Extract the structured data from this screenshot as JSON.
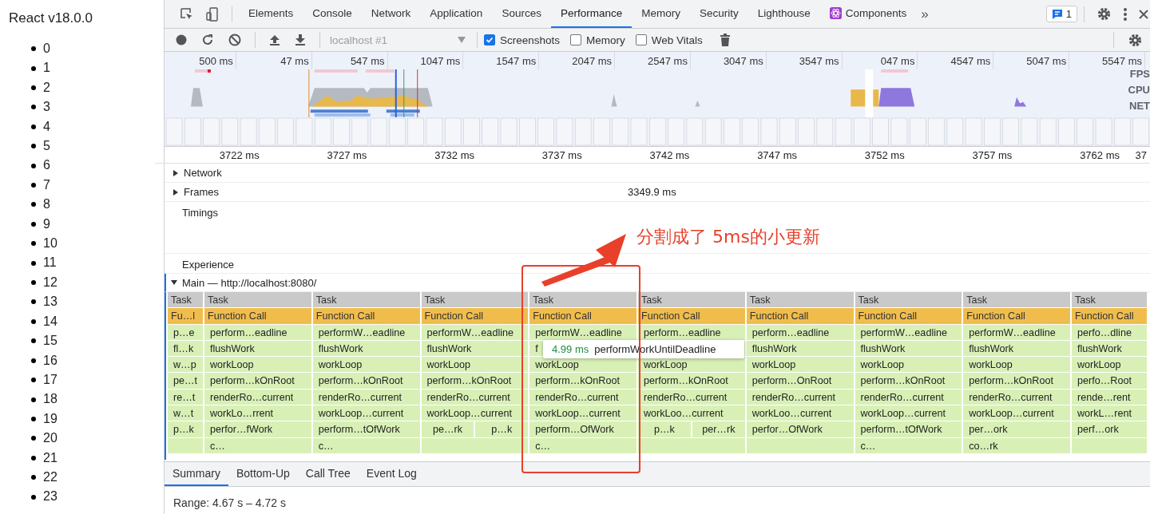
{
  "page": {
    "title": "React v18.0.0",
    "items": [
      "0",
      "1",
      "2",
      "3",
      "4",
      "5",
      "6",
      "7",
      "8",
      "9",
      "10",
      "11",
      "12",
      "13",
      "14",
      "15",
      "16",
      "17",
      "18",
      "19",
      "20",
      "21",
      "22",
      "23"
    ]
  },
  "devtools": {
    "tabs": [
      {
        "label": "Elements",
        "kind": "panel",
        "selected": false
      },
      {
        "label": "Console",
        "kind": "panel",
        "selected": false
      },
      {
        "label": "Network",
        "kind": "panel",
        "selected": false
      },
      {
        "label": "Application",
        "kind": "panel",
        "selected": false
      },
      {
        "label": "Sources",
        "kind": "panel",
        "selected": false
      },
      {
        "label": "Performance",
        "kind": "panel",
        "selected": true
      },
      {
        "label": "Memory",
        "kind": "panel",
        "selected": false
      },
      {
        "label": "Security",
        "kind": "panel",
        "selected": false
      },
      {
        "label": "Lighthouse",
        "kind": "panel",
        "selected": false
      },
      {
        "label": "Components",
        "kind": "plugin",
        "selected": false
      }
    ],
    "more": "»",
    "issues_count": "1",
    "toolbar": {
      "profile": "localhost #1",
      "checkboxes": [
        {
          "label": "Screenshots",
          "checked": true
        },
        {
          "label": "Memory",
          "checked": false
        },
        {
          "label": "Web Vitals",
          "checked": false
        }
      ]
    },
    "overview": {
      "ticks": [
        "500 ms",
        "47 ms",
        "547 ms",
        "1047 ms",
        "1547 ms",
        "2047 ms",
        "2547 ms",
        "3047 ms",
        "3547 ms",
        "047 ms",
        "4547 ms",
        "5047 ms",
        "5547 ms"
      ],
      "lanes": [
        "FPS",
        "CPU",
        "NET"
      ]
    },
    "ruler": [
      "3722 ms",
      "3727 ms",
      "3732 ms",
      "3737 ms",
      "3742 ms",
      "3747 ms",
      "3752 ms",
      "3757 ms",
      "3762 ms",
      "37"
    ],
    "tracks": [
      {
        "kind": "group",
        "label": "Network",
        "expanded": false
      },
      {
        "kind": "group",
        "label": "Frames",
        "expanded": false,
        "value": "3349.9 ms"
      },
      {
        "kind": "plain",
        "label": "Timings"
      },
      {
        "kind": "plain",
        "label": "Experience"
      }
    ],
    "main": {
      "label": "Main — http://localhost:8080/",
      "expanded": true
    },
    "flame": [
      {
        "task": "Task",
        "call": "Fu…l",
        "frames": [
          {
            "kind": "frame",
            "label": "p…e"
          },
          {
            "kind": "frame",
            "label": "fl…k"
          },
          {
            "kind": "frame",
            "label": "w…p"
          },
          {
            "kind": "frame",
            "label": "pe…t"
          },
          {
            "kind": "frame",
            "label": "re…t"
          },
          {
            "kind": "frame",
            "label": "w…t"
          },
          {
            "kind": "frame",
            "label": "p…k"
          }
        ]
      },
      {
        "task": "Task",
        "call": "Function Call",
        "frames": [
          {
            "kind": "frame",
            "label": "perform…eadline"
          },
          {
            "kind": "frame",
            "label": "flushWork"
          },
          {
            "kind": "frame",
            "label": "workLoop"
          },
          {
            "kind": "frame",
            "label": "perform…kOnRoot"
          },
          {
            "kind": "frame",
            "label": "renderRo…current"
          },
          {
            "kind": "frame",
            "label": "workLo…rrent"
          },
          {
            "kind": "frame",
            "label": "perfor…fWork"
          },
          {
            "kind": "frame",
            "label": "c…"
          }
        ]
      },
      {
        "task": "Task",
        "call": "Function Call",
        "frames": [
          {
            "kind": "frame",
            "label": "performW…eadline"
          },
          {
            "kind": "frame",
            "label": "flushWork"
          },
          {
            "kind": "frame",
            "label": "workLoop"
          },
          {
            "kind": "frame",
            "label": "perform…kOnRoot"
          },
          {
            "kind": "frame",
            "label": "renderRo…current"
          },
          {
            "kind": "frame",
            "label": "workLoop…current"
          },
          {
            "kind": "frame",
            "label": "perform…tOfWork"
          },
          {
            "kind": "frame",
            "label": "c…"
          }
        ]
      },
      {
        "task": "Task",
        "call": "Function Call",
        "frames": [
          {
            "kind": "frame",
            "label": "performW…eadline"
          },
          {
            "kind": "frame",
            "label": "flushWork"
          },
          {
            "kind": "frame",
            "label": "workLoop"
          },
          {
            "kind": "frame",
            "label": "perform…kOnRoot"
          },
          {
            "kind": "frame",
            "label": "renderRo…current"
          },
          {
            "kind": "frame",
            "label": "workLoop…current"
          },
          {
            "kind": "split",
            "labels": [
              "pe…rk",
              "p…k"
            ]
          }
        ]
      },
      {
        "task": "Task",
        "call": "Function Call",
        "frames": [
          {
            "kind": "frame",
            "label": "performW…eadline"
          },
          {
            "kind": "frame",
            "label": "f"
          },
          {
            "kind": "frame",
            "label": "workLoop"
          },
          {
            "kind": "frame",
            "label": "perform…kOnRoot"
          },
          {
            "kind": "frame",
            "label": "renderRo…current"
          },
          {
            "kind": "frame",
            "label": "workLoop…current"
          },
          {
            "kind": "frame",
            "label": "perform…OfWork"
          },
          {
            "kind": "frame",
            "label": "c…"
          }
        ]
      },
      {
        "task": "Task",
        "call": "Function Call",
        "frames": [
          {
            "kind": "frame",
            "label": "perform…eadline"
          },
          {
            "kind": "blank"
          },
          {
            "kind": "frame",
            "label": "workLoop"
          },
          {
            "kind": "frame",
            "label": "perform…kOnRoot"
          },
          {
            "kind": "frame",
            "label": "renderRo…current"
          },
          {
            "kind": "frame",
            "label": "workLoo…current"
          },
          {
            "kind": "split",
            "labels": [
              "p…k",
              "per…rk"
            ]
          }
        ]
      },
      {
        "task": "Task",
        "call": "Function Call",
        "frames": [
          {
            "kind": "frame",
            "label": "perform…eadline"
          },
          {
            "kind": "frame",
            "label": "flushWork"
          },
          {
            "kind": "frame",
            "label": "workLoop"
          },
          {
            "kind": "frame",
            "label": "perform…OnRoot"
          },
          {
            "kind": "frame",
            "label": "renderRo…current"
          },
          {
            "kind": "frame",
            "label": "workLoo…current"
          },
          {
            "kind": "frame",
            "label": "perfor…OfWork"
          }
        ]
      },
      {
        "task": "Task",
        "call": "Function Call",
        "frames": [
          {
            "kind": "frame",
            "label": "performW…eadline"
          },
          {
            "kind": "frame",
            "label": "flushWork"
          },
          {
            "kind": "frame",
            "label": "workLoop"
          },
          {
            "kind": "frame",
            "label": "perform…kOnRoot"
          },
          {
            "kind": "frame",
            "label": "renderRo…current"
          },
          {
            "kind": "frame",
            "label": "workLoop…current"
          },
          {
            "kind": "frame",
            "label": "perform…tOfWork"
          },
          {
            "kind": "frame",
            "label": "c…"
          }
        ]
      },
      {
        "task": "Task",
        "call": "Function Call",
        "frames": [
          {
            "kind": "frame",
            "label": "performW…eadline"
          },
          {
            "kind": "frame",
            "label": "flushWork"
          },
          {
            "kind": "frame",
            "label": "workLoop"
          },
          {
            "kind": "frame",
            "label": "perform…kOnRoot"
          },
          {
            "kind": "frame",
            "label": "renderRo…current"
          },
          {
            "kind": "frame",
            "label": "workLoop…current"
          },
          {
            "kind": "frame",
            "label": "per…ork"
          },
          {
            "kind": "frame",
            "label": "co…rk"
          }
        ]
      },
      {
        "task": "Task",
        "call": "Function Call",
        "frames": [
          {
            "kind": "frame",
            "label": "perfo…dline"
          },
          {
            "kind": "frame",
            "label": "flushWork"
          },
          {
            "kind": "frame",
            "label": "workLoop"
          },
          {
            "kind": "frame",
            "label": "perfo…Root"
          },
          {
            "kind": "frame",
            "label": "rende…rent"
          },
          {
            "kind": "frame",
            "label": "workL…rent"
          },
          {
            "kind": "frame",
            "label": "perf…ork"
          }
        ]
      }
    ],
    "tooltip": {
      "duration": "4.99 ms",
      "name": "performWorkUntilDeadline"
    },
    "bottom_tabs": [
      {
        "label": "Summary",
        "selected": true
      },
      {
        "label": "Bottom-Up",
        "selected": false
      },
      {
        "label": "Call Tree",
        "selected": false
      },
      {
        "label": "Event Log",
        "selected": false
      }
    ],
    "range": "Range: 4.67 s – 4.72 s"
  },
  "annotation": {
    "text": "分割成了 5ms的小更新"
  }
}
